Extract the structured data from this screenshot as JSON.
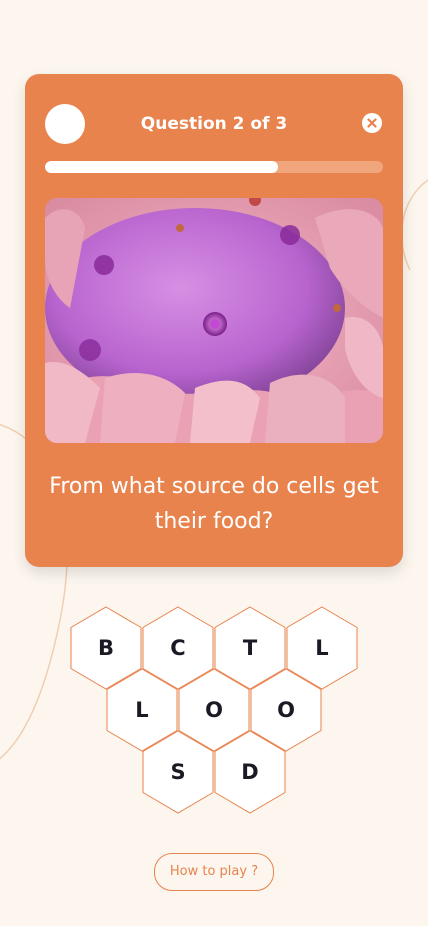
{
  "quiz": {
    "counter_label": "Question 2 of 3",
    "progress_fraction": 0.69,
    "question": "From what source do cells get their food?",
    "image_alt": "Magnified view of a cell"
  },
  "board": {
    "letters": [
      "B",
      "C",
      "T",
      "L",
      "L",
      "O",
      "O",
      "S",
      "D"
    ]
  },
  "footer": {
    "how_to_play_label": "How to play ?"
  },
  "colors": {
    "accent": "#e8834e",
    "background": "#fcf6ef",
    "progress_track": "#f1a57c"
  },
  "icons": {
    "close": "close-icon"
  }
}
